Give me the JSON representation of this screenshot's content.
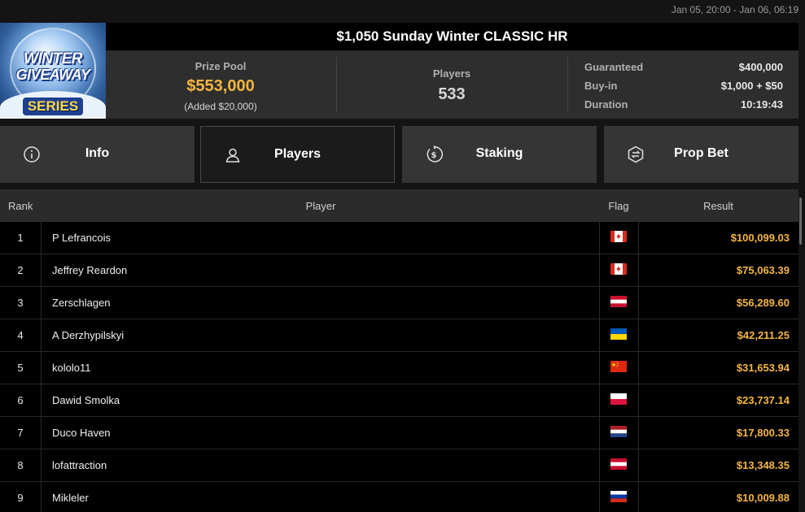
{
  "header": {
    "date_range": "Jan 05, 20:00 - Jan 06, 06:19",
    "tournament_title": "$1,050 Sunday Winter CLASSIC HR",
    "logo": {
      "line1": "WINTER",
      "line2": "GIVEAWAY",
      "line3": "SERIES"
    }
  },
  "summary": {
    "prize_pool_label": "Prize Pool",
    "prize_pool_value": "$553,000",
    "prize_pool_added": "(Added $20,000)",
    "players_label": "Players",
    "players_value": "533",
    "guaranteed_label": "Guaranteed",
    "guaranteed_value": "$400,000",
    "buyin_label": "Buy-in",
    "buyin_value": "$1,000 + $50",
    "duration_label": "Duration",
    "duration_value": "10:19:43"
  },
  "tabs": [
    {
      "label": "Info",
      "icon": "info-icon"
    },
    {
      "label": "Players",
      "icon": "user-icon"
    },
    {
      "label": "Staking",
      "icon": "dollar-coin-icon"
    },
    {
      "label": "Prop Bet",
      "icon": "prop-bet-icon"
    }
  ],
  "active_tab": "Players",
  "table": {
    "columns": {
      "rank": "Rank",
      "player": "Player",
      "flag": "Flag",
      "result": "Result"
    },
    "rows": [
      {
        "rank": "1",
        "player": "P Lefrancois",
        "flag": "canada-flag",
        "result": "$100,099.03"
      },
      {
        "rank": "2",
        "player": "Jeffrey Reardon",
        "flag": "canada-flag",
        "result": "$75,063.39"
      },
      {
        "rank": "3",
        "player": "Zerschlagen",
        "flag": "austria-flag",
        "result": "$56,289.60"
      },
      {
        "rank": "4",
        "player": "A Derzhypilskyi",
        "flag": "ukraine-flag",
        "result": "$42,211.25"
      },
      {
        "rank": "5",
        "player": "kololo11",
        "flag": "china-flag",
        "result": "$31,653.94"
      },
      {
        "rank": "6",
        "player": "Dawid Smolka",
        "flag": "poland-flag",
        "result": "$23,737.14"
      },
      {
        "rank": "7",
        "player": "Duco Haven",
        "flag": "netherlands-flag",
        "result": "$17,800.33"
      },
      {
        "rank": "8",
        "player": "lofattraction",
        "flag": "austria-flag",
        "result": "$13,348.35"
      },
      {
        "rank": "9",
        "player": "Mikleler",
        "flag": "russia-flag",
        "result": "$10,009.88"
      }
    ]
  },
  "colors": {
    "accent_gold": "#f5b640",
    "background": "#141414",
    "panel": "#2e2e2e",
    "row_bg": "#000000"
  }
}
